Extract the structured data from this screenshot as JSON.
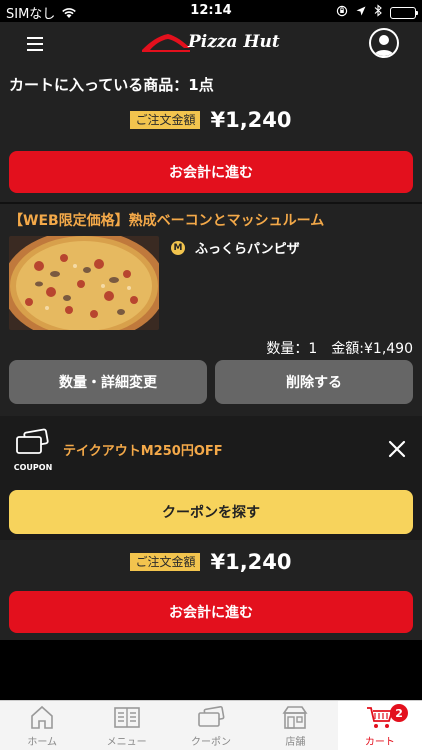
{
  "status_bar": {
    "carrier": "SIMなし",
    "time": "12:14"
  },
  "header": {
    "logo_text": "Pizza Hut",
    "menu_icon": "hamburger-icon",
    "profile_icon": "user-icon"
  },
  "cart": {
    "count_label": "カートに入っている商品：1点",
    "total_label": "ご注文金額",
    "total_amount": "¥1,240",
    "checkout_label": "お会計に進む"
  },
  "item": {
    "title": "【WEB限定価格】熟成ベーコンとマッシュルーム",
    "size_badge": "M",
    "crust": "ふっくらパンピザ",
    "quantity": "数量：1",
    "price": "金額:¥1,490",
    "edit_label": "数量・詳細変更",
    "delete_label": "削除する"
  },
  "coupon": {
    "icon_label": "COUPON",
    "text": "テイクアウトM250円OFF",
    "find_label": "クーポンを探す"
  },
  "tab_bar": {
    "tabs": [
      {
        "label": "ホーム",
        "icon": "home-icon"
      },
      {
        "label": "メニュー",
        "icon": "menu-book-icon"
      },
      {
        "label": "クーポン",
        "icon": "coupon-icon"
      },
      {
        "label": "店舗",
        "icon": "store-icon"
      },
      {
        "label": "カート",
        "icon": "cart-icon",
        "badge": "2",
        "active": true
      }
    ]
  },
  "colors": {
    "accent_red": "#e3101d",
    "badge_yellow": "#f2c44e",
    "title_orange": "#f4a949",
    "coupon_button": "#f7d35c"
  }
}
